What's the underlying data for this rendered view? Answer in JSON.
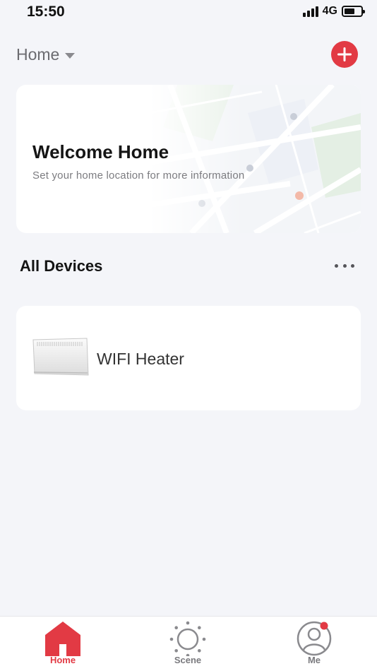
{
  "status_bar": {
    "time": "15:50",
    "network": "4G",
    "battery_level": 0.65
  },
  "header": {
    "home_selector_label": "Home",
    "add_icon": "plus-icon"
  },
  "welcome_card": {
    "title": "Welcome Home",
    "subtitle": "Set your home location for more information"
  },
  "devices_section": {
    "title": "All Devices",
    "more_icon": "more-dots-icon"
  },
  "devices": [
    {
      "name": "WIFI Heater",
      "icon": "panel-heater-image"
    }
  ],
  "tab_bar": {
    "tabs": [
      {
        "label": "Home",
        "icon": "home-icon",
        "active": true
      },
      {
        "label": "Scene",
        "icon": "sun-icon",
        "active": false
      },
      {
        "label": "Me",
        "icon": "profile-icon",
        "active": false,
        "badge": true
      }
    ]
  },
  "colors": {
    "accent": "#e23a44",
    "background": "#f4f5f9",
    "card": "#ffffff",
    "muted_text": "#7c7c80"
  }
}
